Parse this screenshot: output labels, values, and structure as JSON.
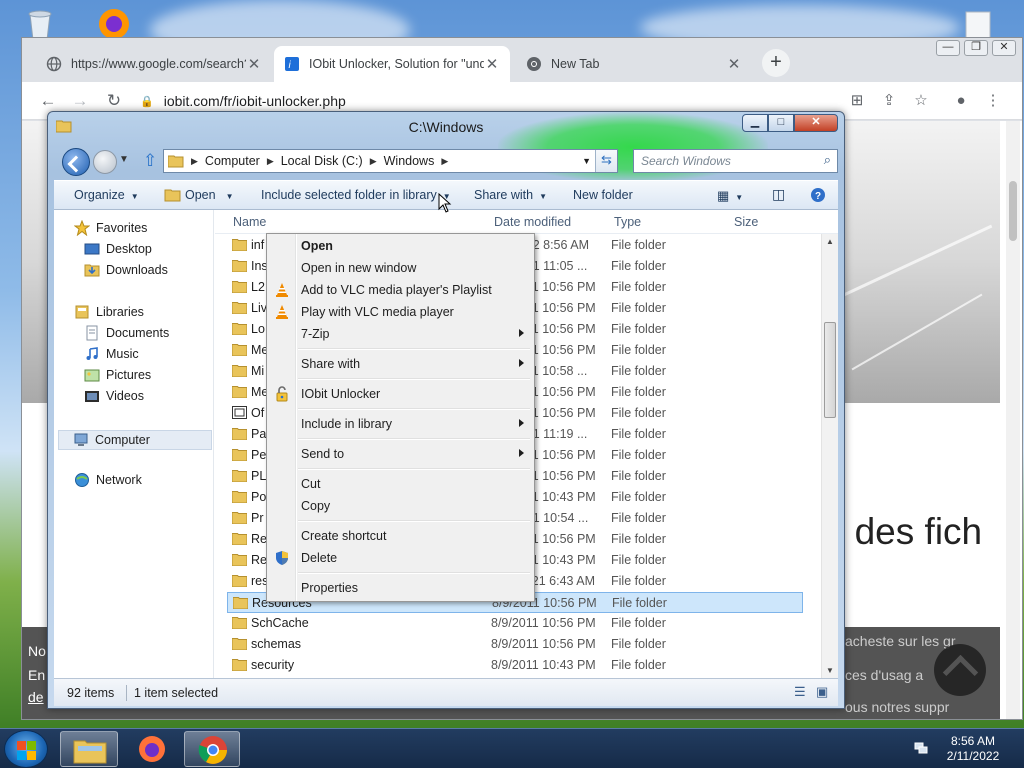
{
  "browser": {
    "tabs": [
      {
        "title": "https://www.google.com/search?",
        "icon": "globe-icon"
      },
      {
        "title": "IObit Unlocker, Solution for \"und",
        "icon": "iobit-icon"
      },
      {
        "title": "New Tab",
        "icon": "chrome-icon"
      }
    ],
    "close_glyph": "✕",
    "new_tab_glyph": "+",
    "url": "iobit.com/fr/iobit-unlocker.php",
    "page": {
      "headline_fragment": "r des fich",
      "cookie_lines": [
        "No",
        "En",
        "de"
      ],
      "cookie_right_lines": [
        "acheste sur les gr",
        "ces d'usag a",
        "ous notres suppr"
      ]
    }
  },
  "explorer": {
    "title": "C:\\Windows",
    "address": {
      "crumbs": [
        "Computer",
        "Local Disk (C:)",
        "Windows"
      ]
    },
    "search_placeholder": "Search Windows",
    "toolbar": {
      "organize": "Organize",
      "open": "Open",
      "include": "Include selected folder in library",
      "share": "Share with",
      "new_folder": "New folder"
    },
    "nav": {
      "favorites": "Favorites",
      "desktop": "Desktop",
      "downloads": "Downloads",
      "libraries": "Libraries",
      "documents": "Documents",
      "music": "Music",
      "pictures": "Pictures",
      "videos": "Videos",
      "computer": "Computer",
      "network": "Network"
    },
    "columns": {
      "name": "Name",
      "date": "Date modified",
      "type": "Type",
      "size": "Size"
    },
    "files": [
      {
        "name": "inf",
        "date": "8/9/2022 8:56 AM",
        "type": "File folder"
      },
      {
        "name": "Ins",
        "date": "9/8/2021 11:05 ...",
        "type": "File folder"
      },
      {
        "name": "L2",
        "date": "8/9/2011 10:56 PM",
        "type": "File folder"
      },
      {
        "name": "Liv",
        "date": "8/9/2011 10:56 PM",
        "type": "File folder"
      },
      {
        "name": "Lo",
        "date": "8/9/2011 10:56 PM",
        "type": "File folder"
      },
      {
        "name": "Me",
        "date": "8/9/2011 10:56 PM",
        "type": "File folder"
      },
      {
        "name": "Mi",
        "date": "8/9/2011 10:58 ...",
        "type": "File folder"
      },
      {
        "name": "Me",
        "date": "8/9/2011 10:56 PM",
        "type": "File folder"
      },
      {
        "name": "Of",
        "date": "8/9/2011 10:56 PM",
        "type": "File folder"
      },
      {
        "name": "Pa",
        "date": "9/8/2021 11:19 ...",
        "type": "File folder"
      },
      {
        "name": "Pe",
        "date": "8/9/2011 10:56 PM",
        "type": "File folder"
      },
      {
        "name": "PL",
        "date": "8/9/2011 10:56 PM",
        "type": "File folder"
      },
      {
        "name": "Po",
        "date": "8/9/2011 10:43 PM",
        "type": "File folder"
      },
      {
        "name": "Pr",
        "date": "9/8/2021 10:54 ...",
        "type": "File folder"
      },
      {
        "name": "Re",
        "date": "8/9/2011 10:56 PM",
        "type": "File folder"
      },
      {
        "name": "Re",
        "date": "8/9/2011 10:43 PM",
        "type": "File folder"
      },
      {
        "name": "res",
        "date": "2/11/2021 6:43 AM",
        "type": "File folder"
      },
      {
        "name": "Resources",
        "date": "8/9/2011 10:56 PM",
        "type": "File folder"
      },
      {
        "name": "SchCache",
        "date": "8/9/2011 10:56 PM",
        "type": "File folder"
      },
      {
        "name": "schemas",
        "date": "8/9/2011 10:56 PM",
        "type": "File folder"
      },
      {
        "name": "security",
        "date": "8/9/2011 10:43 PM",
        "type": "File folder"
      }
    ],
    "status": {
      "count": "92 items",
      "selected": "1 item selected"
    }
  },
  "context_menu": {
    "open": "Open",
    "open_new_window": "Open in new window",
    "vlc_playlist": "Add to VLC media player's Playlist",
    "vlc_play": "Play with VLC media player",
    "zip": "7-Zip",
    "share_with": "Share with",
    "iobit": "IObit Unlocker",
    "include": "Include in library",
    "send_to": "Send to",
    "cut": "Cut",
    "copy": "Copy",
    "shortcut": "Create shortcut",
    "delete": "Delete",
    "properties": "Properties"
  },
  "taskbar": {
    "time": "8:56 AM",
    "date": "2/11/2022"
  },
  "colors": {
    "selection": "#cde6fb",
    "vlc_orange": "#f08a00",
    "glow_green": "#34d84c"
  }
}
